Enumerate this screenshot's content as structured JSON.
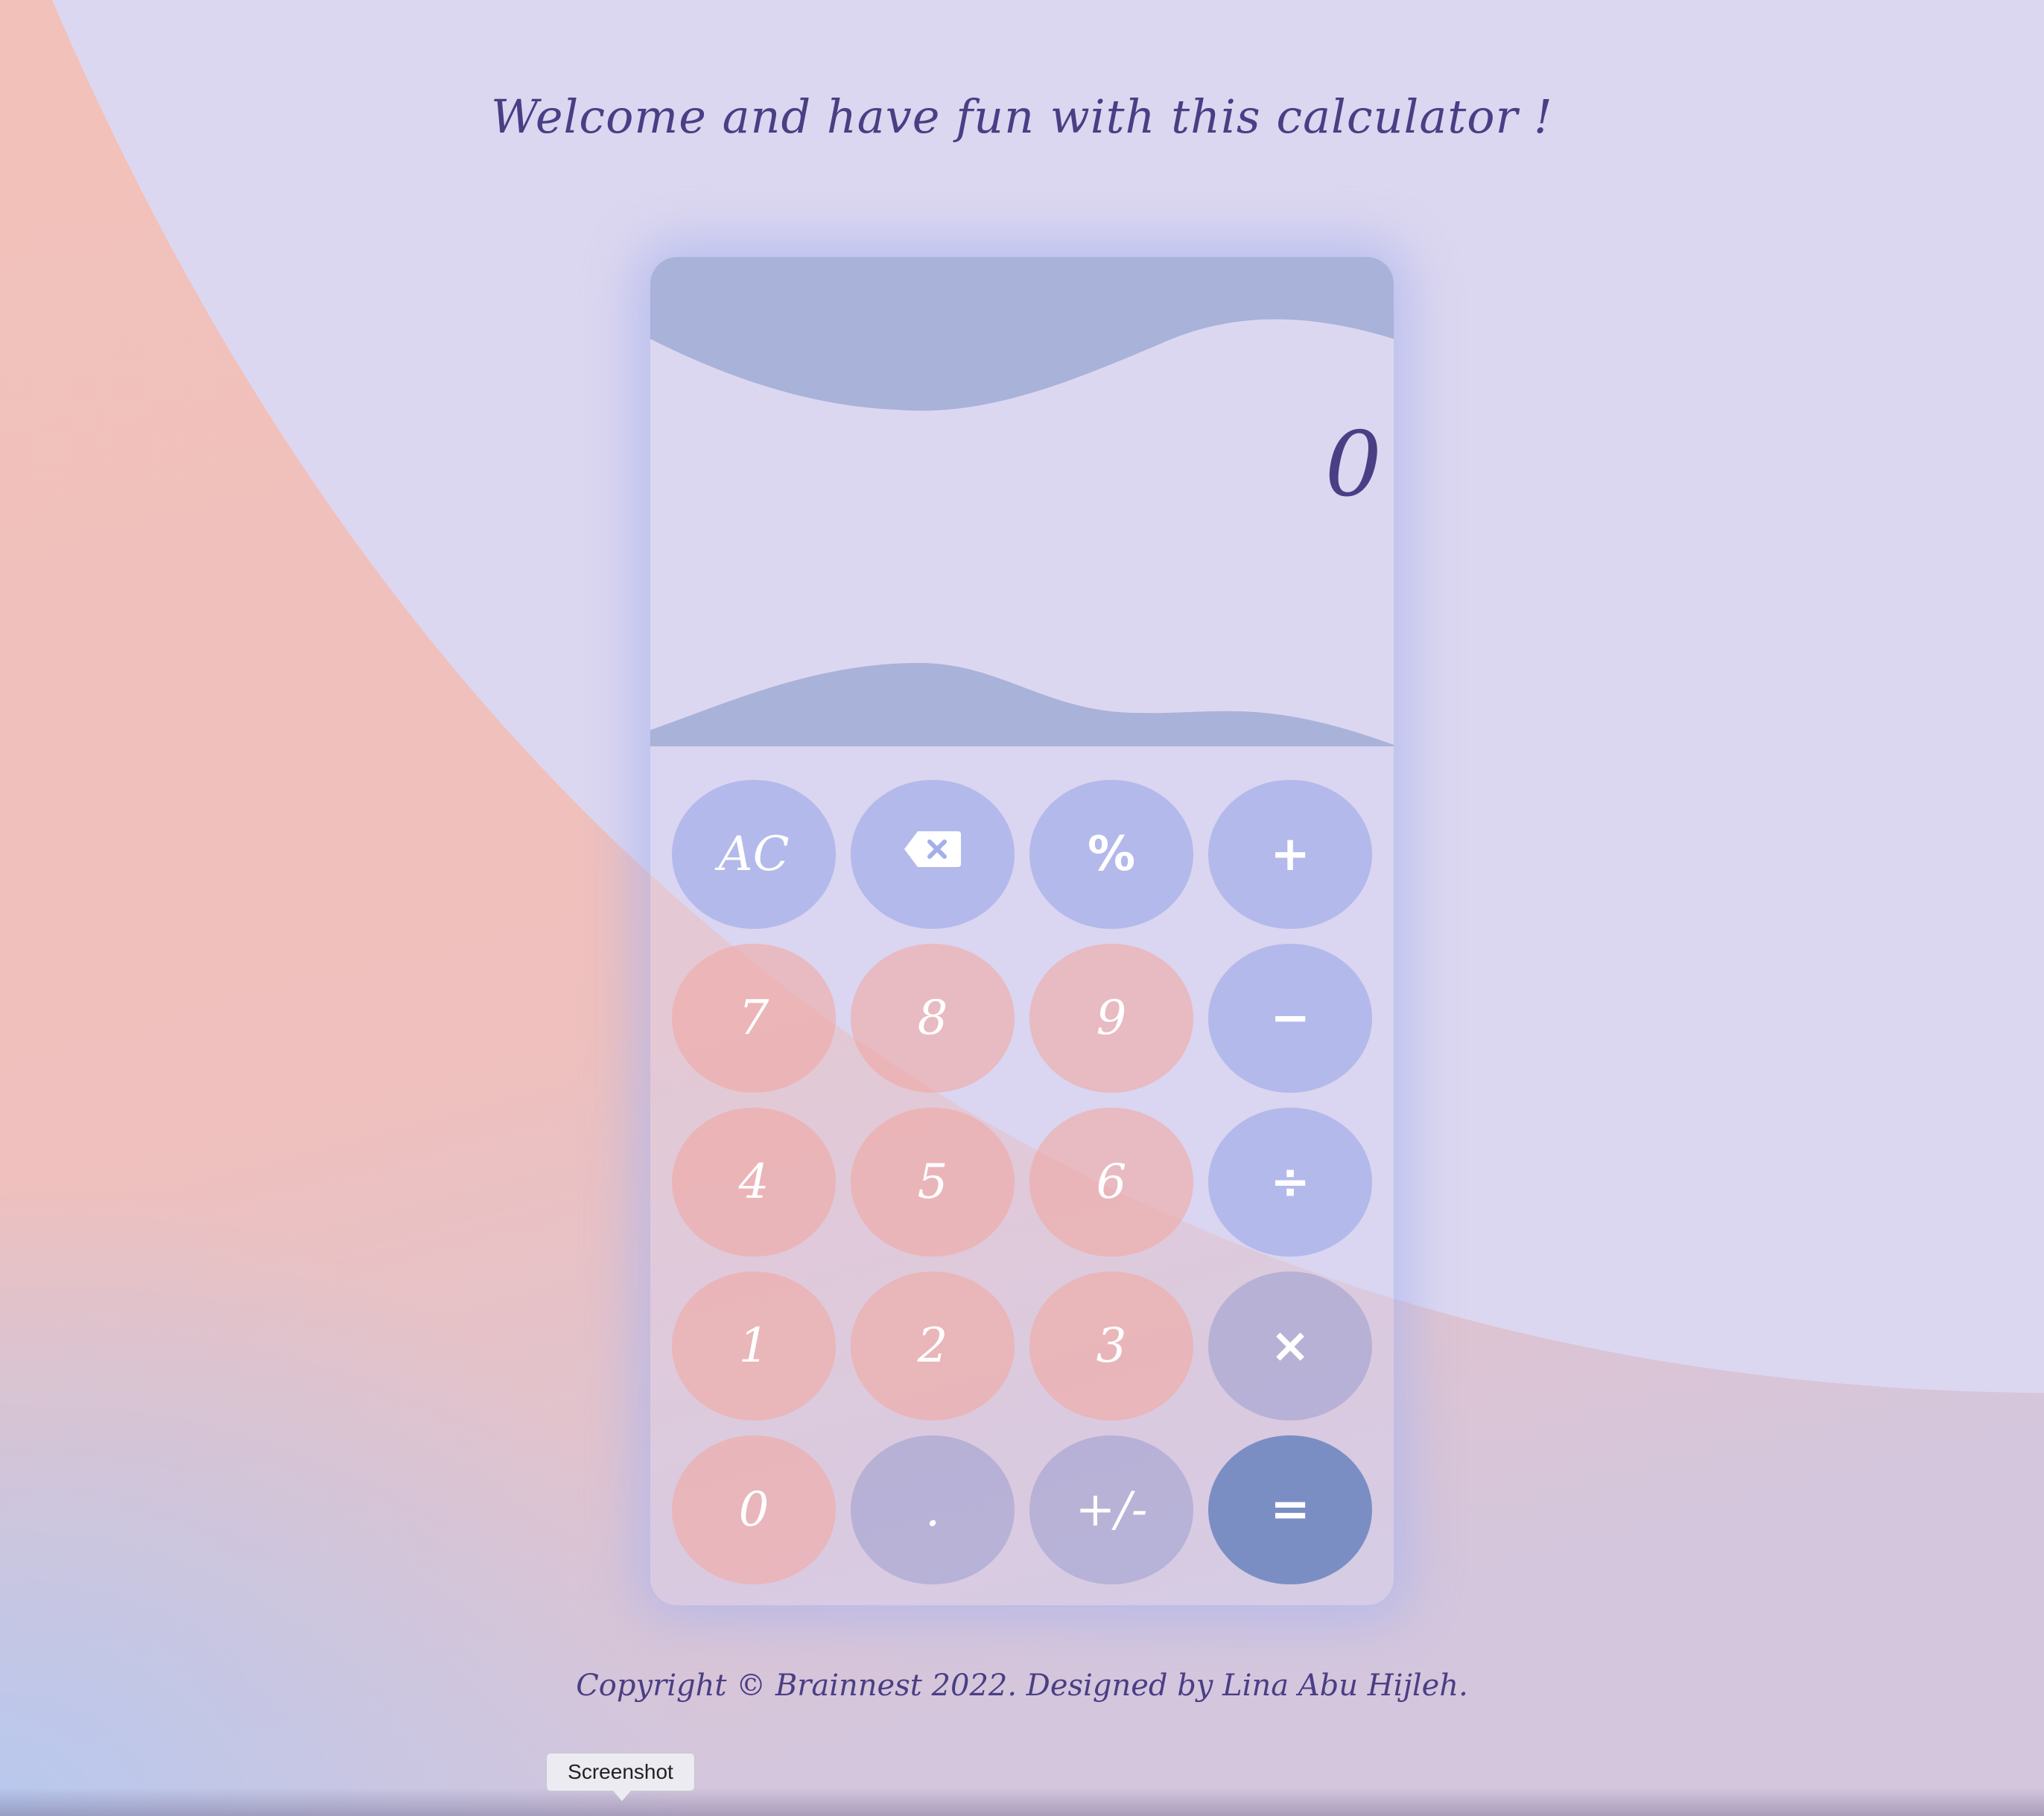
{
  "page": {
    "title": "Welcome and have fun with this calculator !",
    "footer": "Copyright © Brainnest 2022. Designed by Lina Abu Hijleh."
  },
  "display": {
    "value": "0"
  },
  "keys": {
    "ac": "AC",
    "backspace": "backspace-icon",
    "percent": "%",
    "add": "+",
    "seven": "7",
    "eight": "8",
    "nine": "9",
    "subtract": "−",
    "four": "4",
    "five": "5",
    "six": "6",
    "divide": "÷",
    "one": "1",
    "two": "2",
    "three": "3",
    "multiply": "×",
    "zero": "0",
    "decimal": ".",
    "sign": "+/-",
    "equals": "="
  },
  "tooltip": {
    "label": "Screenshot"
  },
  "colors": {
    "background": "#dcd7f0",
    "accent_pink": "#f0b5ae",
    "operator_blue": "#a3afe8",
    "equals_blue": "#7b8ec4",
    "text_purple": "#4a3e85"
  }
}
